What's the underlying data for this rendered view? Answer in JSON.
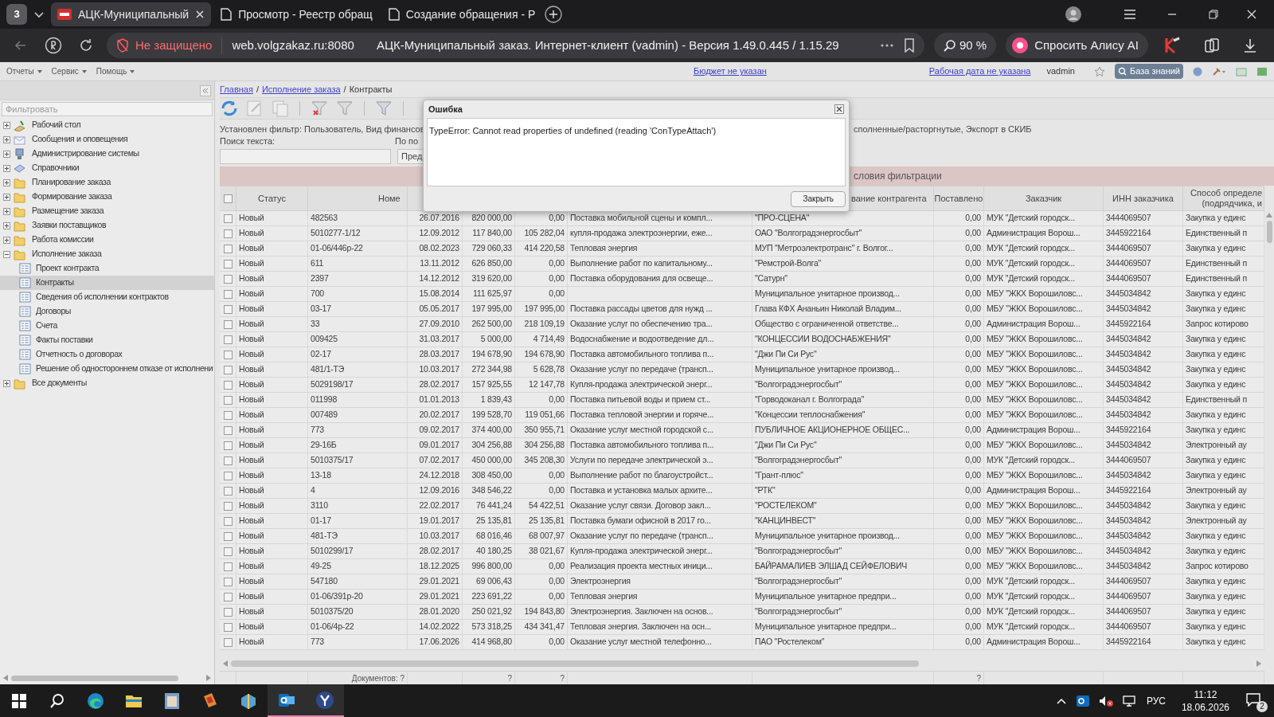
{
  "browser": {
    "tab_count": "3",
    "tabs": [
      {
        "title": "АЦК-Муниципальный",
        "selected": true,
        "kind": "app"
      },
      {
        "title": "Просмотр - Реестр обращ",
        "selected": false,
        "kind": "doc"
      },
      {
        "title": "Создание обращения - Р",
        "selected": false,
        "kind": "doc"
      }
    ],
    "security": "Не защищено",
    "url": "web.volgzakaz.ru:8080",
    "page_title": "АЦК-Муниципальный заказ. Интернет-клиент (vadmin) - Версия 1.49.0.445 / 1.15.29",
    "zoom": "90 %",
    "assistant": "Спросить Алису AI"
  },
  "app_menu": [
    "Отчеты",
    "Сервис",
    "Помощь"
  ],
  "app_header": {
    "budget": "Бюджет не указан",
    "work_date": "Рабочая дата не указана",
    "user": "vadmin",
    "knowledge_base": "База знаний"
  },
  "sidebar": {
    "filter_placeholder": "Фильтровать",
    "items": [
      {
        "label": "Рабочий стол",
        "kind": "desk",
        "expanded": false,
        "selected": false
      },
      {
        "label": "Сообщения и оповещения",
        "kind": "mail",
        "expanded": false,
        "selected": false
      },
      {
        "label": "Администрирование системы",
        "kind": "computer",
        "expanded": false,
        "selected": false
      },
      {
        "label": "Справочники",
        "kind": "book",
        "expanded": false,
        "selected": false
      },
      {
        "label": "Планирование заказа",
        "kind": "folder",
        "expanded": false,
        "selected": false
      },
      {
        "label": "Формирование заказа",
        "kind": "folder",
        "expanded": false,
        "selected": false
      },
      {
        "label": "Размещение заказа",
        "kind": "folder",
        "expanded": false,
        "selected": false
      },
      {
        "label": "Заявки поставщиков",
        "kind": "folder",
        "expanded": false,
        "selected": false
      },
      {
        "label": "Работа комиссии",
        "kind": "folder",
        "expanded": false,
        "selected": false
      },
      {
        "label": "Исполнение заказа",
        "kind": "folder",
        "expanded": true,
        "selected": false,
        "children": [
          {
            "label": "Проект контракта",
            "kind": "list",
            "selected": false
          },
          {
            "label": "Контракты",
            "kind": "list",
            "selected": true
          },
          {
            "label": "Сведения об исполнении контрактов",
            "kind": "list",
            "selected": false
          },
          {
            "label": "Договоры",
            "kind": "list",
            "selected": false
          },
          {
            "label": "Счета",
            "kind": "list",
            "selected": false
          },
          {
            "label": "Факты поставки",
            "kind": "list",
            "selected": false
          },
          {
            "label": "Отчетность о договорах",
            "kind": "list",
            "selected": false
          },
          {
            "label": "Решение об одностороннем отказе от исполнени",
            "kind": "list",
            "selected": false
          }
        ]
      },
      {
        "label": "Все документы",
        "kind": "folder",
        "expanded": false,
        "selected": false
      }
    ]
  },
  "breadcrumb": [
    {
      "label": "Главная",
      "link": true
    },
    {
      "separator": "/",
      "label": "Исполнение заказа",
      "link": true
    },
    {
      "separator": "/",
      "label": "Контракты",
      "link": false
    }
  ],
  "filter": {
    "text_left": "Установлен фильтр: Пользователь, Вид финансов",
    "text_right": "сполненные/расторгнутые, Экспорт в СКИБ",
    "search_label": "Поиск текста:",
    "by_label": "По по",
    "by_value": "Пред",
    "conditions": "словия фильтрации"
  },
  "table": {
    "all_checked": false,
    "header": {
      "status": "Статус",
      "number": "Номе",
      "counterparty": "вание контрагента",
      "delivered": "Поставлено",
      "customer": "Заказчик",
      "customer_inn": "ИНН заказчика",
      "method": [
        "Способ определе",
        "(подрядчика, и"
      ]
    },
    "rows": [
      {
        "checked": false,
        "status": "Новый",
        "number": "482563",
        "date": "26.07.2016",
        "amount": "820 000,00",
        "paid": "0,00",
        "subject": "Поставка мобильной сцены и компл...",
        "counterparty": "\"ПРО-СЦЕНА\"",
        "delivered": "0,00",
        "customer": "МУК \"Детский городск...",
        "customer_inn": "3444069507",
        "method": "Закупка у единс"
      },
      {
        "checked": false,
        "status": "Новый",
        "number": "5010277-1/12",
        "date": "12.09.2012",
        "amount": "117 840,00",
        "paid": "105 282,04",
        "subject": "купля-продажа электроэнергии, еже...",
        "counterparty": "ОАО \"Волгоградэнергосбыт\"",
        "delivered": "0,00",
        "customer": "Администрация Ворош...",
        "customer_inn": "3445922164",
        "method": "Единственный п"
      },
      {
        "checked": false,
        "status": "Новый",
        "number": "01-06/446р-22",
        "date": "08.02.2023",
        "amount": "729 060,33",
        "paid": "414 220,58",
        "subject": "Тепловая энергия",
        "counterparty": "МУП \"Метроэлектротранс\" г. Волгог...",
        "delivered": "0,00",
        "customer": "МУК \"Детский городск...",
        "customer_inn": "3444069507",
        "method": "Закупка у единс"
      },
      {
        "checked": false,
        "status": "Новый",
        "number": "611",
        "date": "13.11.2012",
        "amount": "626 850,00",
        "paid": "0,00",
        "subject": "Выполнение работ по капитальному...",
        "counterparty": "\"Ремстрой-Волга\"",
        "delivered": "0,00",
        "customer": "МУК \"Детский городск...",
        "customer_inn": "3444069507",
        "method": "Единственный п"
      },
      {
        "checked": false,
        "status": "Новый",
        "number": "2397",
        "date": "14.12.2012",
        "amount": "319 620,00",
        "paid": "0,00",
        "subject": "Поставка оборудования для освеще...",
        "counterparty": "\"Сатурн\"",
        "delivered": "0,00",
        "customer": "МУК \"Детский городск...",
        "customer_inn": "3444069507",
        "method": "Единственный п"
      },
      {
        "checked": false,
        "status": "Новый",
        "number": "700",
        "date": "15.08.2014",
        "amount": "111 625,97",
        "paid": "0,00",
        "counterparty": "Муниципальное унитарное производ...",
        "delivered": "0,00",
        "customer": "МБУ \"ЖКХ Ворошиловс...",
        "customer_inn": "3445034842",
        "method": "Закупка у единс"
      },
      {
        "checked": false,
        "status": "Новый",
        "number": "03-17",
        "date": "05.05.2017",
        "amount": "197 995,00",
        "paid": "197 995,00",
        "subject": "Поставка рассады цветов для нужд ...",
        "counterparty": "Глава КФХ Ананьин Николай Владим...",
        "delivered": "0,00",
        "customer": "МБУ \"ЖКХ Ворошиловс...",
        "customer_inn": "3445034842",
        "method": "Закупка у единс"
      },
      {
        "checked": false,
        "status": "Новый",
        "number": "33",
        "date": "27.09.2010",
        "amount": "262 500,00",
        "paid": "218 109,19",
        "subject": "Оказание услуг по обеспечению тра...",
        "counterparty": "Общество с ограниченной ответстве...",
        "delivered": "0,00",
        "customer": "Администрация Ворош...",
        "customer_inn": "3445922164",
        "method": "Запрос котирово"
      },
      {
        "checked": false,
        "status": "Новый",
        "number": "009425",
        "date": "31.03.2017",
        "amount": "5 000,00",
        "paid": "4 714,49",
        "subject": "Водоснабжение и водоотведение дл...",
        "counterparty": "\"КОНЦЕССИИ ВОДОСНАБЖЕНИЯ\"",
        "delivered": "0,00",
        "customer": "МБУ \"ЖКХ Ворошиловс...",
        "customer_inn": "3445034842",
        "method": "Закупка у единс"
      },
      {
        "checked": false,
        "status": "Новый",
        "number": "02-17",
        "date": "28.03.2017",
        "amount": "194 678,90",
        "paid": "194 678,90",
        "subject": "Поставка автомобильного топлива п...",
        "counterparty": "\"Джи Пи Си Рус\"",
        "delivered": "0,00",
        "customer": "МБУ \"ЖКХ Ворошиловс...",
        "customer_inn": "3445034842",
        "method": "Закупка у единс"
      },
      {
        "checked": false,
        "status": "Новый",
        "number": "481/1-ТЭ",
        "date": "10.03.2017",
        "amount": "272 344,98",
        "paid": "5 628,78",
        "subject": "Оказание услуг по передаче (трансп...",
        "counterparty": "Муниципальное унитарное производ...",
        "delivered": "0,00",
        "customer": "МБУ \"ЖКХ Ворошиловс...",
        "customer_inn": "3445034842",
        "method": "Закупка у единс"
      },
      {
        "checked": false,
        "status": "Новый",
        "number": "5029198/17",
        "date": "28.02.2017",
        "amount": "157 925,55",
        "paid": "12 147,78",
        "subject": "Купля-продажа электрической энерг...",
        "counterparty": "\"Волгоградэнергосбыт\"",
        "delivered": "0,00",
        "customer": "МБУ \"ЖКХ Ворошиловс...",
        "customer_inn": "3445034842",
        "method": "Закупка у единс"
      },
      {
        "checked": false,
        "status": "Новый",
        "number": "011998",
        "date": "01.01.2013",
        "amount": "1 839,43",
        "paid": "0,00",
        "subject": "Поставка питьевой воды и прием ст...",
        "counterparty": "\"Горводоканал г. Волгограда\"",
        "delivered": "0,00",
        "customer": "МБУ \"ЖКХ Ворошиловс...",
        "customer_inn": "3445034842",
        "method": "Единственный п"
      },
      {
        "checked": false,
        "status": "Новый",
        "number": "007489",
        "date": "20.02.2017",
        "amount": "199 528,70",
        "paid": "119 051,66",
        "subject": "Поставка тепловой энергии и горяче...",
        "counterparty": "\"Концессии теплоснабжения\"",
        "delivered": "0,00",
        "customer": "МБУ \"ЖКХ Ворошиловс...",
        "customer_inn": "3445034842",
        "method": "Закупка у единс"
      },
      {
        "checked": false,
        "status": "Новый",
        "number": "773",
        "date": "09.02.2017",
        "amount": "374 400,00",
        "paid": "350 955,71",
        "subject": "Оказание услуг местной городской с...",
        "counterparty": "ПУБЛИЧНОЕ АКЦИОНЕРНОЕ ОБЩЕС...",
        "delivered": "0,00",
        "customer": "Администрация Ворош...",
        "customer_inn": "3445922164",
        "method": "Закупка у единс"
      },
      {
        "checked": false,
        "status": "Новый",
        "number": "29-16Б",
        "date": "09.01.2017",
        "amount": "304 256,88",
        "paid": "304 256,88",
        "subject": "Поставка автомобильного топлива п...",
        "counterparty": "\"Джи Пи Си Рус\"",
        "delivered": "0,00",
        "customer": "МБУ \"ЖКХ Ворошиловс...",
        "customer_inn": "3445034842",
        "method": "Электронный ау"
      },
      {
        "checked": false,
        "status": "Новый",
        "number": "5010375/17",
        "date": "07.02.2017",
        "amount": "450 000,00",
        "paid": "345 208,30",
        "subject": "Услуги по передаче электрической э...",
        "counterparty": "\"Волгоградэнергосбыт\"",
        "delivered": "0,00",
        "customer": "МУК \"Детский городск...",
        "customer_inn": "3444069507",
        "method": "Закупка у единс"
      },
      {
        "checked": false,
        "status": "Новый",
        "number": "13-18",
        "date": "24.12.2018",
        "amount": "308 450,00",
        "paid": "0,00",
        "subject": "Выполнение работ по благоустройст...",
        "counterparty": "\"Грант-плюс\"",
        "delivered": "0,00",
        "customer": "МБУ \"ЖКХ Ворошиловс...",
        "customer_inn": "3445034842",
        "method": "Закупка у единс"
      },
      {
        "checked": false,
        "status": "Новый",
        "number": "4",
        "date": "12.09.2016",
        "amount": "348 546,22",
        "paid": "0,00",
        "subject": "Поставка и установка малых архите...",
        "counterparty": "\"РТК\"",
        "delivered": "0,00",
        "customer": "Администрация Ворош...",
        "customer_inn": "3445922164",
        "method": "Электронный ау"
      },
      {
        "checked": false,
        "status": "Новый",
        "number": "3110",
        "date": "22.02.2017",
        "amount": "76 441,24",
        "paid": "54 422,51",
        "subject": "Оказание услуг связи. Договор закл...",
        "counterparty": "\"РОСТЕЛЕКОМ\"",
        "delivered": "0,00",
        "customer": "МБУ \"ЖКХ Ворошиловс...",
        "customer_inn": "3445034842",
        "method": "Закупка у единс"
      },
      {
        "checked": false,
        "status": "Новый",
        "number": "01-17",
        "date": "19.01.2017",
        "amount": "25 135,81",
        "paid": "25 135,81",
        "subject": "Поставка бумаги офисной в 2017 го...",
        "counterparty": "\"КАНЦИНВЕСТ\"",
        "delivered": "0,00",
        "customer": "МБУ \"ЖКХ Ворошиловс...",
        "customer_inn": "3445034842",
        "method": "Электронный ау"
      },
      {
        "checked": false,
        "status": "Новый",
        "number": "481-ТЭ",
        "date": "10.03.2017",
        "amount": "68 016,46",
        "paid": "68 007,97",
        "subject": "Оказание услуг по передаче (трансп...",
        "counterparty": "Муниципальное унитарное производ...",
        "delivered": "0,00",
        "customer": "МБУ \"ЖКХ Ворошиловс...",
        "customer_inn": "3445034842",
        "method": "Закупка у единс"
      },
      {
        "checked": false,
        "status": "Новый",
        "number": "5010299/17",
        "date": "28.02.2017",
        "amount": "40 180,25",
        "paid": "38 021,67",
        "subject": "Купля-продажа электрической энерг...",
        "counterparty": "\"Волгоградэнергосбыт\"",
        "delivered": "0,00",
        "customer": "МБУ \"ЖКХ Ворошиловс...",
        "customer_inn": "3445034842",
        "method": "Закупка у единс"
      },
      {
        "checked": false,
        "status": "Новый",
        "number": "49-25",
        "date": "18.12.2025",
        "amount": "996 800,00",
        "paid": "0,00",
        "subject": "Реализация проекта местных иници...",
        "counterparty": "БАЙРАМАЛИЕВ ЭЛШАД СЕЙФЕЛОВИЧ",
        "delivered": "0,00",
        "customer": "МБУ \"ЖКХ Ворошиловс...",
        "customer_inn": "3445034842",
        "method": "Запрос котирово"
      },
      {
        "checked": false,
        "status": "Новый",
        "number": "547180",
        "date": "29.01.2021",
        "amount": "69 006,43",
        "paid": "0,00",
        "subject": "Электроэнергия",
        "counterparty": "\"Волгоградэнергосбыт\"",
        "delivered": "0,00",
        "customer": "МУК \"Детский городск...",
        "customer_inn": "3444069507",
        "method": "Закупка у единс"
      },
      {
        "checked": false,
        "status": "Новый",
        "number": "01-06/391р-20",
        "date": "29.01.2021",
        "amount": "223 691,22",
        "paid": "0,00",
        "subject": "Тепловая энергия",
        "counterparty": "Муниципальное унитарное предпри...",
        "delivered": "0,00",
        "customer": "МУК \"Детский городск...",
        "customer_inn": "3444069507",
        "method": "Закупка у единс"
      },
      {
        "checked": false,
        "status": "Новый",
        "number": "5010375/20",
        "date": "28.01.2020",
        "amount": "250 021,92",
        "paid": "194 843,80",
        "subject": "Электроэнергия. Заключен на основ...",
        "counterparty": "\"Волгоградэнергосбыт\"",
        "delivered": "0,00",
        "customer": "МУК \"Детский городск...",
        "customer_inn": "3444069507",
        "method": "Закупка у единс"
      },
      {
        "checked": false,
        "status": "Новый",
        "number": "01-06/4р-22",
        "date": "14.02.2022",
        "amount": "573 318,25",
        "paid": "434 341,47",
        "subject": "Тепловая энергия. Заключен на осн...",
        "counterparty": "Муниципальное унитарное предпри...",
        "delivered": "0,00",
        "customer": "МУК \"Детский городск...",
        "customer_inn": "3444069507",
        "method": "Закупка у единс"
      },
      {
        "checked": false,
        "status": "Новый",
        "number": "773",
        "date": "17.06.2026",
        "amount": "414 968,80",
        "paid": "0,00",
        "subject": "Оказание услуг местной телефонно...",
        "counterparty": "ПАО \"Ростелеком\"",
        "delivered": "0,00",
        "customer": "Администрация Ворош...",
        "customer_inn": "3445922164",
        "method": "Закупка у единс"
      }
    ],
    "footer": {
      "documents": "Документов: ?",
      "amount": "?",
      "paid": "?",
      "delivered": "?"
    }
  },
  "dialog": {
    "title": "Ошибка",
    "message": "TypeError: Cannot read properties of undefined (reading 'ConTypeAttach')",
    "button": "Закрыть"
  },
  "taskbar": {
    "language": "РУС",
    "time": "11:12",
    "date": "18.06.2026",
    "notifications": "2"
  }
}
